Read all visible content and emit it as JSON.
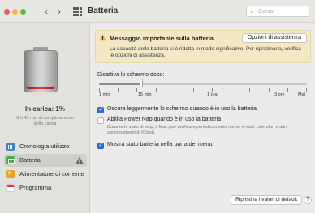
{
  "window": {
    "title": "Batteria",
    "search_placeholder": "Cerca",
    "icons": {
      "back": "chevron-left-icon",
      "forward": "chevron-right-icon",
      "grid": "grid-icon",
      "search": "search-icon"
    }
  },
  "sidebar": {
    "battery_level": 0.01,
    "charge_label": "In carica: 1%",
    "charge_sub_line1": "2 h 45 min al completamento",
    "charge_sub_line2": "della carica",
    "items": [
      {
        "label": "Cronologia utilizzo",
        "icon": "usage-history-icon",
        "active": false
      },
      {
        "label": "Batteria",
        "icon": "battery-icon",
        "active": true,
        "warning": true
      },
      {
        "label": "Alimentatore di corrente",
        "icon": "power-adapter-icon",
        "active": false
      },
      {
        "label": "Programma",
        "icon": "schedule-icon",
        "active": false
      }
    ]
  },
  "alert": {
    "title": "Messaggio importante sulla batteria",
    "button": "Opzioni di assistenza",
    "body": "La capacità della batteria si è ridotta in modo significativo. Per ripristinarla, verifica le opzioni di assistenza."
  },
  "display_sleep": {
    "label": "Disattiva lo schermo dopo:",
    "value_label": "15 min",
    "value_fraction": 0.205,
    "tick_labels": [
      "1 min",
      "15 min",
      "1 ora",
      "3 ore",
      "Mai"
    ]
  },
  "options": [
    {
      "label": "Oscura leggermente lo schermo quando è in uso la batteria",
      "checked": true,
      "description": ""
    },
    {
      "label": "Abilita Power Nap quando è in uso la batteria",
      "checked": false,
      "description": "Durante lo stato di stop, il Mac può verificare periodicamente nuove e-mail, calendari e altri aggiornamenti di iCloud."
    },
    {
      "label": "Mostra stato batteria nella barra dei menu",
      "checked": true,
      "description": ""
    }
  ],
  "footer": {
    "reset_button": "Ripristina i valori di default",
    "help_button": "?"
  },
  "colors": {
    "accent": "#2c6fdc",
    "warning": "#f0b429",
    "battery_low": "#e33a3a"
  }
}
